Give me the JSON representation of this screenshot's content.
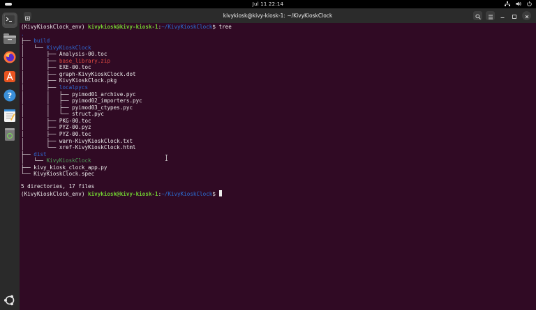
{
  "topbar": {
    "datetime": "Jul 11  22:14"
  },
  "window": {
    "title": "kivykiosk@kivy-kiosk-1: ~/KivyKioskClock"
  },
  "terminal": {
    "prompt_env": "(KivyKioskClock_env) ",
    "prompt_user": "kivykiosk@kivy-kiosk-1",
    "prompt_colon": ":",
    "prompt_path": "~/KivyKioskClock",
    "prompt_dollar": "$ ",
    "command": "tree",
    "dot": ".",
    "lines": [
      {
        "prefix": "├── ",
        "name": "build",
        "kind": "dir"
      },
      {
        "prefix": "│   └── ",
        "name": "KivyKioskClock",
        "kind": "dir"
      },
      {
        "prefix": "│       ├── ",
        "name": "Analysis-00.toc",
        "kind": "file"
      },
      {
        "prefix": "│       ├── ",
        "name": "base_library.zip",
        "kind": "zip"
      },
      {
        "prefix": "│       ├── ",
        "name": "EXE-00.toc",
        "kind": "file"
      },
      {
        "prefix": "│       ├── ",
        "name": "graph-KivyKioskClock.dot",
        "kind": "file"
      },
      {
        "prefix": "│       ├── ",
        "name": "KivyKioskClock.pkg",
        "kind": "file"
      },
      {
        "prefix": "│       ├── ",
        "name": "localpycs",
        "kind": "dir"
      },
      {
        "prefix": "│       │   ├── ",
        "name": "pyimod01_archive.pyc",
        "kind": "file"
      },
      {
        "prefix": "│       │   ├── ",
        "name": "pyimod02_importers.pyc",
        "kind": "file"
      },
      {
        "prefix": "│       │   ├── ",
        "name": "pyimod03_ctypes.pyc",
        "kind": "file"
      },
      {
        "prefix": "│       │   └── ",
        "name": "struct.pyc",
        "kind": "file"
      },
      {
        "prefix": "│       ├── ",
        "name": "PKG-00.toc",
        "kind": "file"
      },
      {
        "prefix": "│       ├── ",
        "name": "PYZ-00.pyz",
        "kind": "file"
      },
      {
        "prefix": "│       ├── ",
        "name": "PYZ-00.toc",
        "kind": "file"
      },
      {
        "prefix": "│       ├── ",
        "name": "warn-KivyKioskClock.txt",
        "kind": "file"
      },
      {
        "prefix": "│       └── ",
        "name": "xref-KivyKioskClock.html",
        "kind": "file"
      },
      {
        "prefix": "├── ",
        "name": "dist",
        "kind": "dir"
      },
      {
        "prefix": "│   └── ",
        "name": "KivyKioskClock",
        "kind": "exec"
      },
      {
        "prefix": "├── ",
        "name": "kivy_kiosk_clock_app.py",
        "kind": "file"
      },
      {
        "prefix": "└── ",
        "name": "KivyKioskClock.spec",
        "kind": "file"
      }
    ],
    "summary": "5 directories, 17 files"
  },
  "dock": {
    "items": [
      {
        "name": "terminal",
        "icon": "terminal-icon"
      },
      {
        "name": "files",
        "icon": "files-icon"
      },
      {
        "name": "firefox",
        "icon": "firefox-icon"
      },
      {
        "name": "app-center",
        "icon": "app-center-icon"
      },
      {
        "name": "help",
        "icon": "help-icon"
      },
      {
        "name": "text-editor",
        "icon": "text-editor-icon"
      },
      {
        "name": "trash",
        "icon": "trash-icon"
      }
    ]
  },
  "colors": {
    "terminal_bg": "#300a24",
    "dir": "#2e6bd6",
    "exec": "#4fa35a",
    "zip": "#e04a42",
    "prompt_user": "#72d132"
  }
}
